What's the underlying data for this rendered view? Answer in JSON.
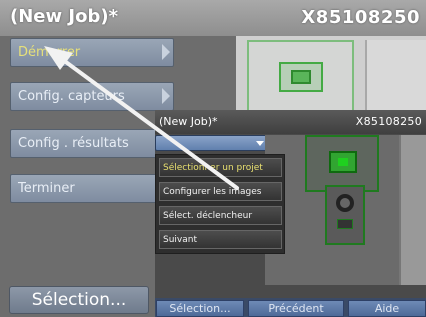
{
  "titlebar": {
    "job": "(New Job)*",
    "serial": "X85108250"
  },
  "menu": {
    "items": [
      {
        "label": "Démarrer"
      },
      {
        "label": "Config. capteurs"
      },
      {
        "label": "Config . résultats"
      },
      {
        "label": "Terminer"
      }
    ],
    "selection_button": "Sélection..."
  },
  "nested": {
    "job": "(New Job)*",
    "serial": "X85108250",
    "menu_items": [
      {
        "label": "Sélectionner un projet"
      },
      {
        "label": "Configurer les images"
      },
      {
        "label": "Sélect. déclencheur"
      },
      {
        "label": "Suivant"
      }
    ],
    "buttons": {
      "selection": "Sélection...",
      "previous": "Précédent",
      "help": "Aide"
    }
  },
  "colors": {
    "accent_green": "#1f7a1f",
    "button_blue": "#6e8ab6",
    "active_text": "#e6e07a"
  }
}
